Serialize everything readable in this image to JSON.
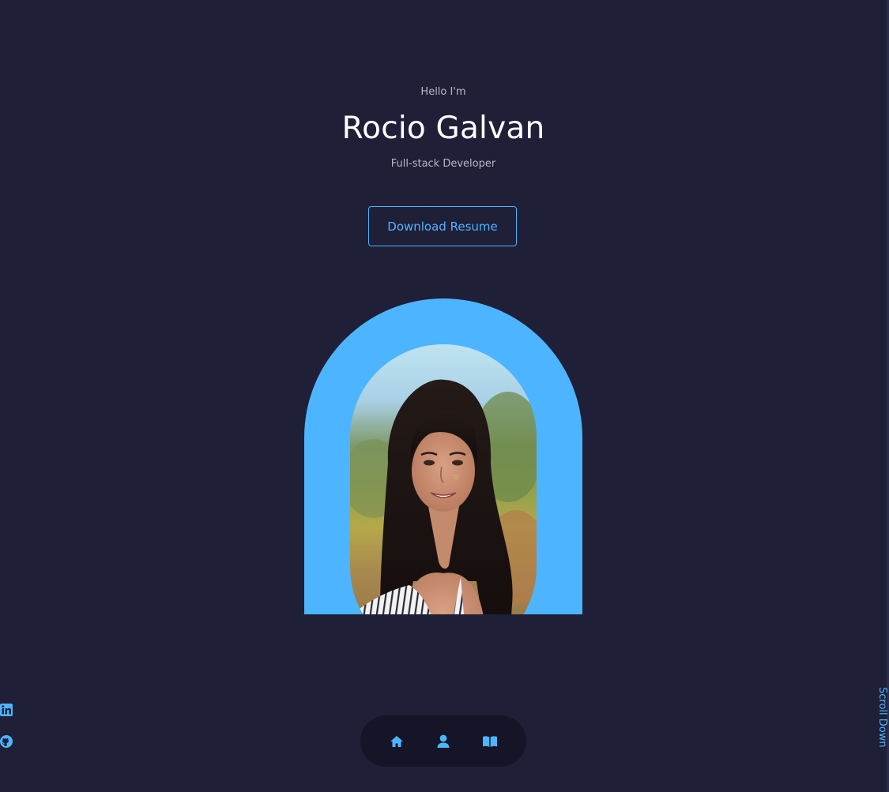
{
  "hero": {
    "greeting": "Hello I'm",
    "name": "Rocio Galvan",
    "role": "Full-stack Developer",
    "download_label": "Download Resume"
  },
  "socials": {
    "items": [
      "linkedin-icon",
      "github-icon"
    ]
  },
  "scroll": {
    "label": "Scroll Down"
  },
  "nav": {
    "items": [
      "home-icon",
      "user-icon",
      "book-icon"
    ]
  },
  "colors": {
    "background": "#1f1f38",
    "accent": "#4db5ff",
    "text_light": "#b8b8c8",
    "text_white": "#ffffff"
  }
}
